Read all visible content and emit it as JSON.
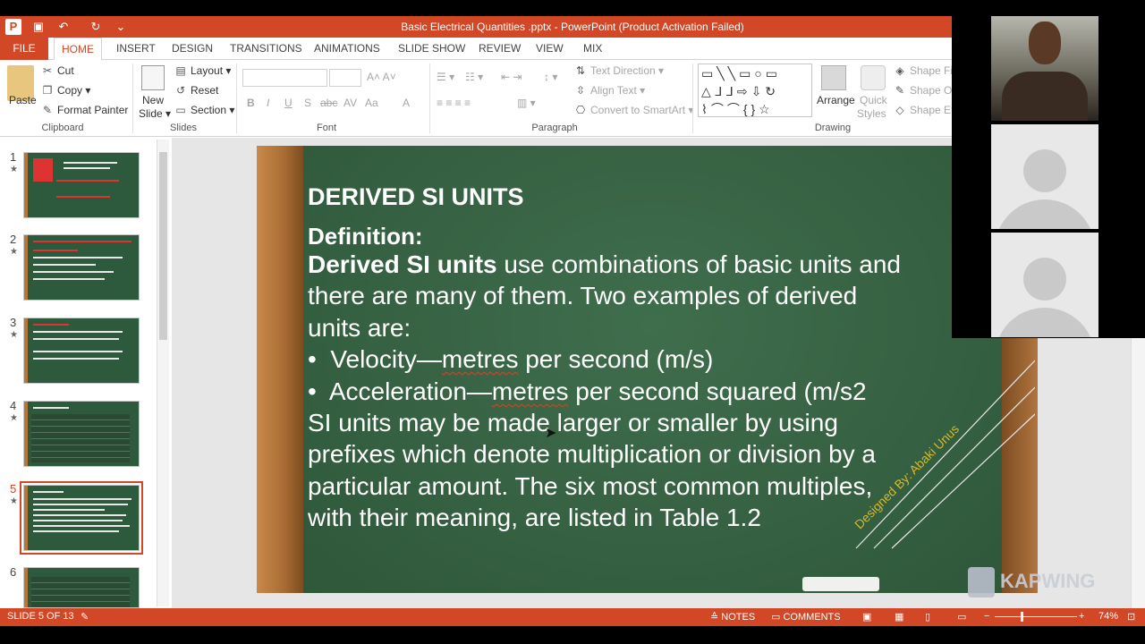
{
  "window": {
    "title": "Basic Electrical Quantities .pptx -  PowerPoint (Product Activation Failed)"
  },
  "tabs": [
    "FILE",
    "HOME",
    "INSERT",
    "DESIGN",
    "TRANSITIONS",
    "ANIMATIONS",
    "SLIDE SHOW",
    "REVIEW",
    "VIEW",
    "MIX"
  ],
  "ribbon": {
    "clipboard": {
      "label": "Clipboard",
      "paste": "Paste",
      "cut": "Cut",
      "copy": "Copy",
      "format_painter": "Format Painter"
    },
    "slides": {
      "label": "Slides",
      "new_slide_1": "New",
      "new_slide_2": "Slide",
      "layout": "Layout",
      "reset": "Reset",
      "section": "Section"
    },
    "font": {
      "label": "Font",
      "bold": "B",
      "italic": "I",
      "underline": "U",
      "shadow": "S",
      "strike": "abc",
      "spacing": "AV",
      "case": "Aa",
      "color": "A"
    },
    "paragraph": {
      "label": "Paragraph",
      "text_direction": "Text Direction",
      "align_text": "Align Text",
      "convert_smartart": "Convert to SmartArt"
    },
    "drawing": {
      "label": "Drawing",
      "arrange": "Arrange",
      "quick_styles_1": "Quick",
      "quick_styles_2": "Styles",
      "shape_fill": "Shape Fill",
      "shape_outline": "Shape Ou",
      "shape_effects": "Shape Eff"
    }
  },
  "thumbnails": [
    {
      "num": "1",
      "star": "★"
    },
    {
      "num": "2",
      "star": "★"
    },
    {
      "num": "3",
      "star": "★"
    },
    {
      "num": "4",
      "star": "★"
    },
    {
      "num": "5",
      "star": "★"
    },
    {
      "num": "6",
      "star": ""
    }
  ],
  "slide": {
    "title": "DERIVED SI UNITS",
    "definition": "Definition:",
    "line1_bold": "Derived SI units",
    "line1_rest": " use combinations of basic units and",
    "line2": "there are many of them. Two examples of derived",
    "line3": "units are:",
    "bullet": "•",
    "b1_pre": "Velocity—",
    "b1_squig": "metres",
    "b1_post": " per second (m/s)",
    "b2_pre": "Acceleration—",
    "b2_squig": "metres",
    "b2_post": " per second squared (m/s2",
    "line4": "SI units may be made larger or smaller by using",
    "line5": "prefixes which denote multiplication or division by a",
    "line6": "particular amount. The six most common multiples,",
    "line7": "with their meaning, are listed in Table 1.2",
    "designer": "Designed By: Abaki Unus"
  },
  "status": {
    "slide_of": "SLIDE 5 OF 13",
    "notes": "NOTES",
    "comments": "COMMENTS",
    "zoom": "74%"
  },
  "watermark": "KAPWING",
  "colors": {
    "accent": "#d24726",
    "board": "#3a6447"
  }
}
